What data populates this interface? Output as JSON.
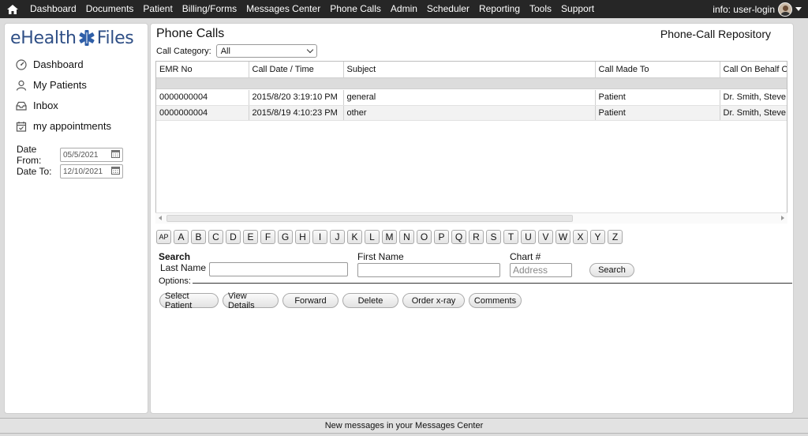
{
  "topnav": {
    "menu": [
      "Dashboard",
      "Documents",
      "Patient",
      "Billing/Forms",
      "Messages Center",
      "Phone Calls",
      "Admin",
      "Scheduler",
      "Reporting",
      "Tools",
      "Support"
    ],
    "user_label": "info: user-login"
  },
  "sidebar": {
    "logo": {
      "left": "eHealth",
      "right": "Files"
    },
    "items": [
      {
        "label": "Dashboard",
        "icon": "dashboard-icon"
      },
      {
        "label": "My Patients",
        "icon": "user-icon"
      },
      {
        "label": "Inbox",
        "icon": "inbox-icon"
      },
      {
        "label": "my appointments",
        "icon": "calendar-check-icon"
      }
    ],
    "date_from": {
      "label": "Date From:",
      "value": "05/5/2021"
    },
    "date_to": {
      "label": "Date To:",
      "value": "12/10/2021"
    }
  },
  "main": {
    "title": "Phone Calls",
    "repository_title": "Phone-Call Repository",
    "category": {
      "label": "Call Category:",
      "value": "All"
    },
    "table": {
      "columns": [
        "EMR No",
        "Call Date / Time",
        "Subject",
        "Call Made To",
        "Call On Behalf Of"
      ],
      "rows": [
        [
          "0000000004",
          "2015/8/20 3:19:10 PM",
          "general",
          "Patient",
          "Dr. Smith, Steve"
        ],
        [
          "0000000004",
          "2015/8/19 4:10:23 PM",
          "other",
          "Patient",
          "Dr. Smith, Steve"
        ]
      ]
    },
    "alphabet": [
      "AP",
      "A",
      "B",
      "C",
      "D",
      "E",
      "F",
      "G",
      "H",
      "I",
      "J",
      "K",
      "L",
      "M",
      "N",
      "O",
      "P",
      "Q",
      "R",
      "S",
      "T",
      "U",
      "V",
      "W",
      "X",
      "Y",
      "Z"
    ],
    "search": {
      "heading": "Search",
      "last_name_label": "Last Name",
      "first_name_label": "First Name",
      "chart_label": "Chart #",
      "chart_placeholder": "Address",
      "button": "Search",
      "options_label": "Options:"
    },
    "actions": [
      "Select Patient",
      "View Details",
      "Forward",
      "Delete",
      "Order x-ray",
      "Comments"
    ]
  },
  "statusbar": {
    "message": "New messages in your Messages Center"
  },
  "colors": {
    "topnav_bg": "#262626",
    "logo_blue": "#2f4f86",
    "page_bg": "#dcdcdc"
  }
}
